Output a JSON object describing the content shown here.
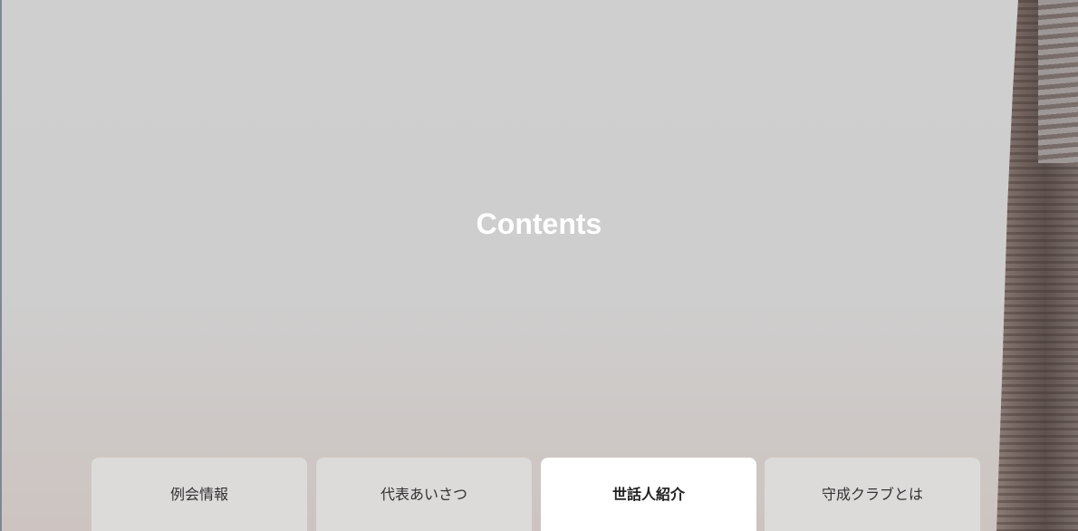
{
  "hero": {
    "title": "Contents"
  },
  "tabs": [
    {
      "label": "例会情報",
      "active": false
    },
    {
      "label": "代表あいさつ",
      "active": false
    },
    {
      "label": "世話人紹介",
      "active": true
    },
    {
      "label": "守成クラブとは",
      "active": false
    }
  ],
  "colors": {
    "hero_overlay": "#cfcfcf",
    "tab_inactive": "#dcdbda",
    "tab_active": "#ffffff",
    "title_text": "#ffffff"
  }
}
